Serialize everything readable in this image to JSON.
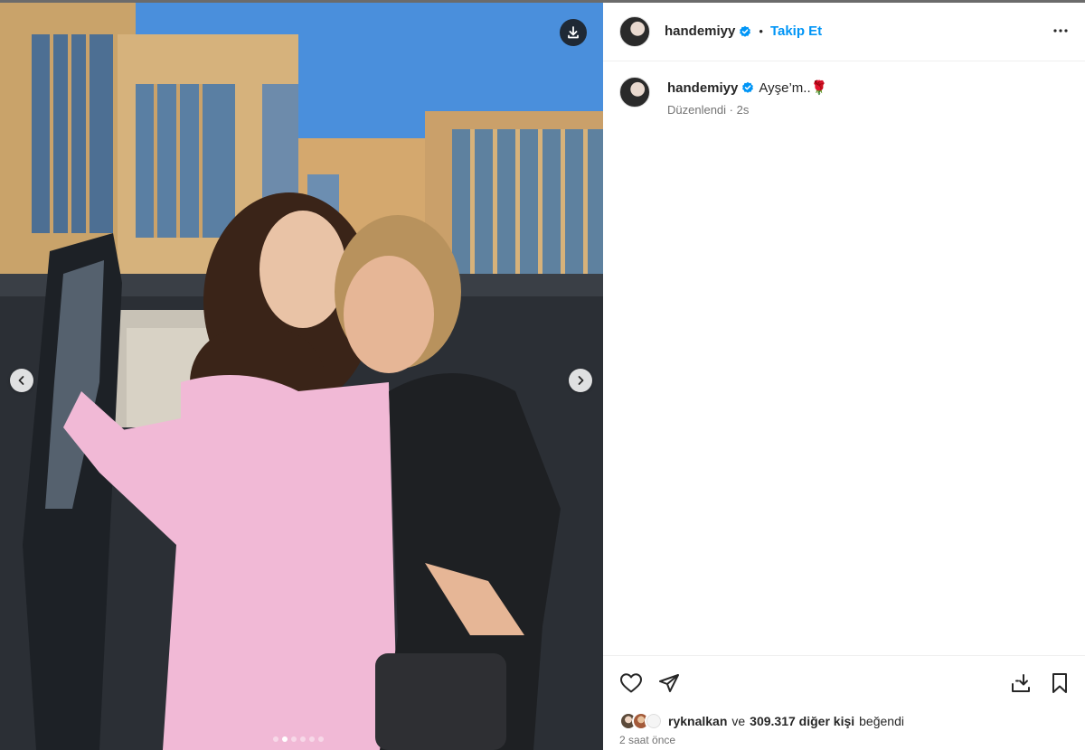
{
  "post": {
    "username": "handemiyy",
    "follow_label": "Takip Et",
    "header_separator": "•",
    "caption": {
      "username": "handemiyy",
      "text": "Ayşe’m..🌹",
      "edited_label": "Düzenlendi",
      "meta_separator": "·",
      "age": "2s"
    },
    "likes": {
      "first_user": "ryknalkan",
      "connector": "ve",
      "others": "309.317 diğer kişi",
      "suffix": "beğendi"
    },
    "time_ago": "2 saat önce",
    "carousel": {
      "total": 6,
      "active_index": 1
    }
  },
  "colors": {
    "accent": "#0095f6",
    "verified": "#0095f6",
    "text": "#262626",
    "muted": "#737373"
  },
  "icons": [
    "download-icon",
    "chevron-left-icon",
    "chevron-right-icon",
    "verified-badge-icon",
    "more-options-icon",
    "heart-icon",
    "share-icon",
    "save-download-icon",
    "bookmark-icon"
  ]
}
